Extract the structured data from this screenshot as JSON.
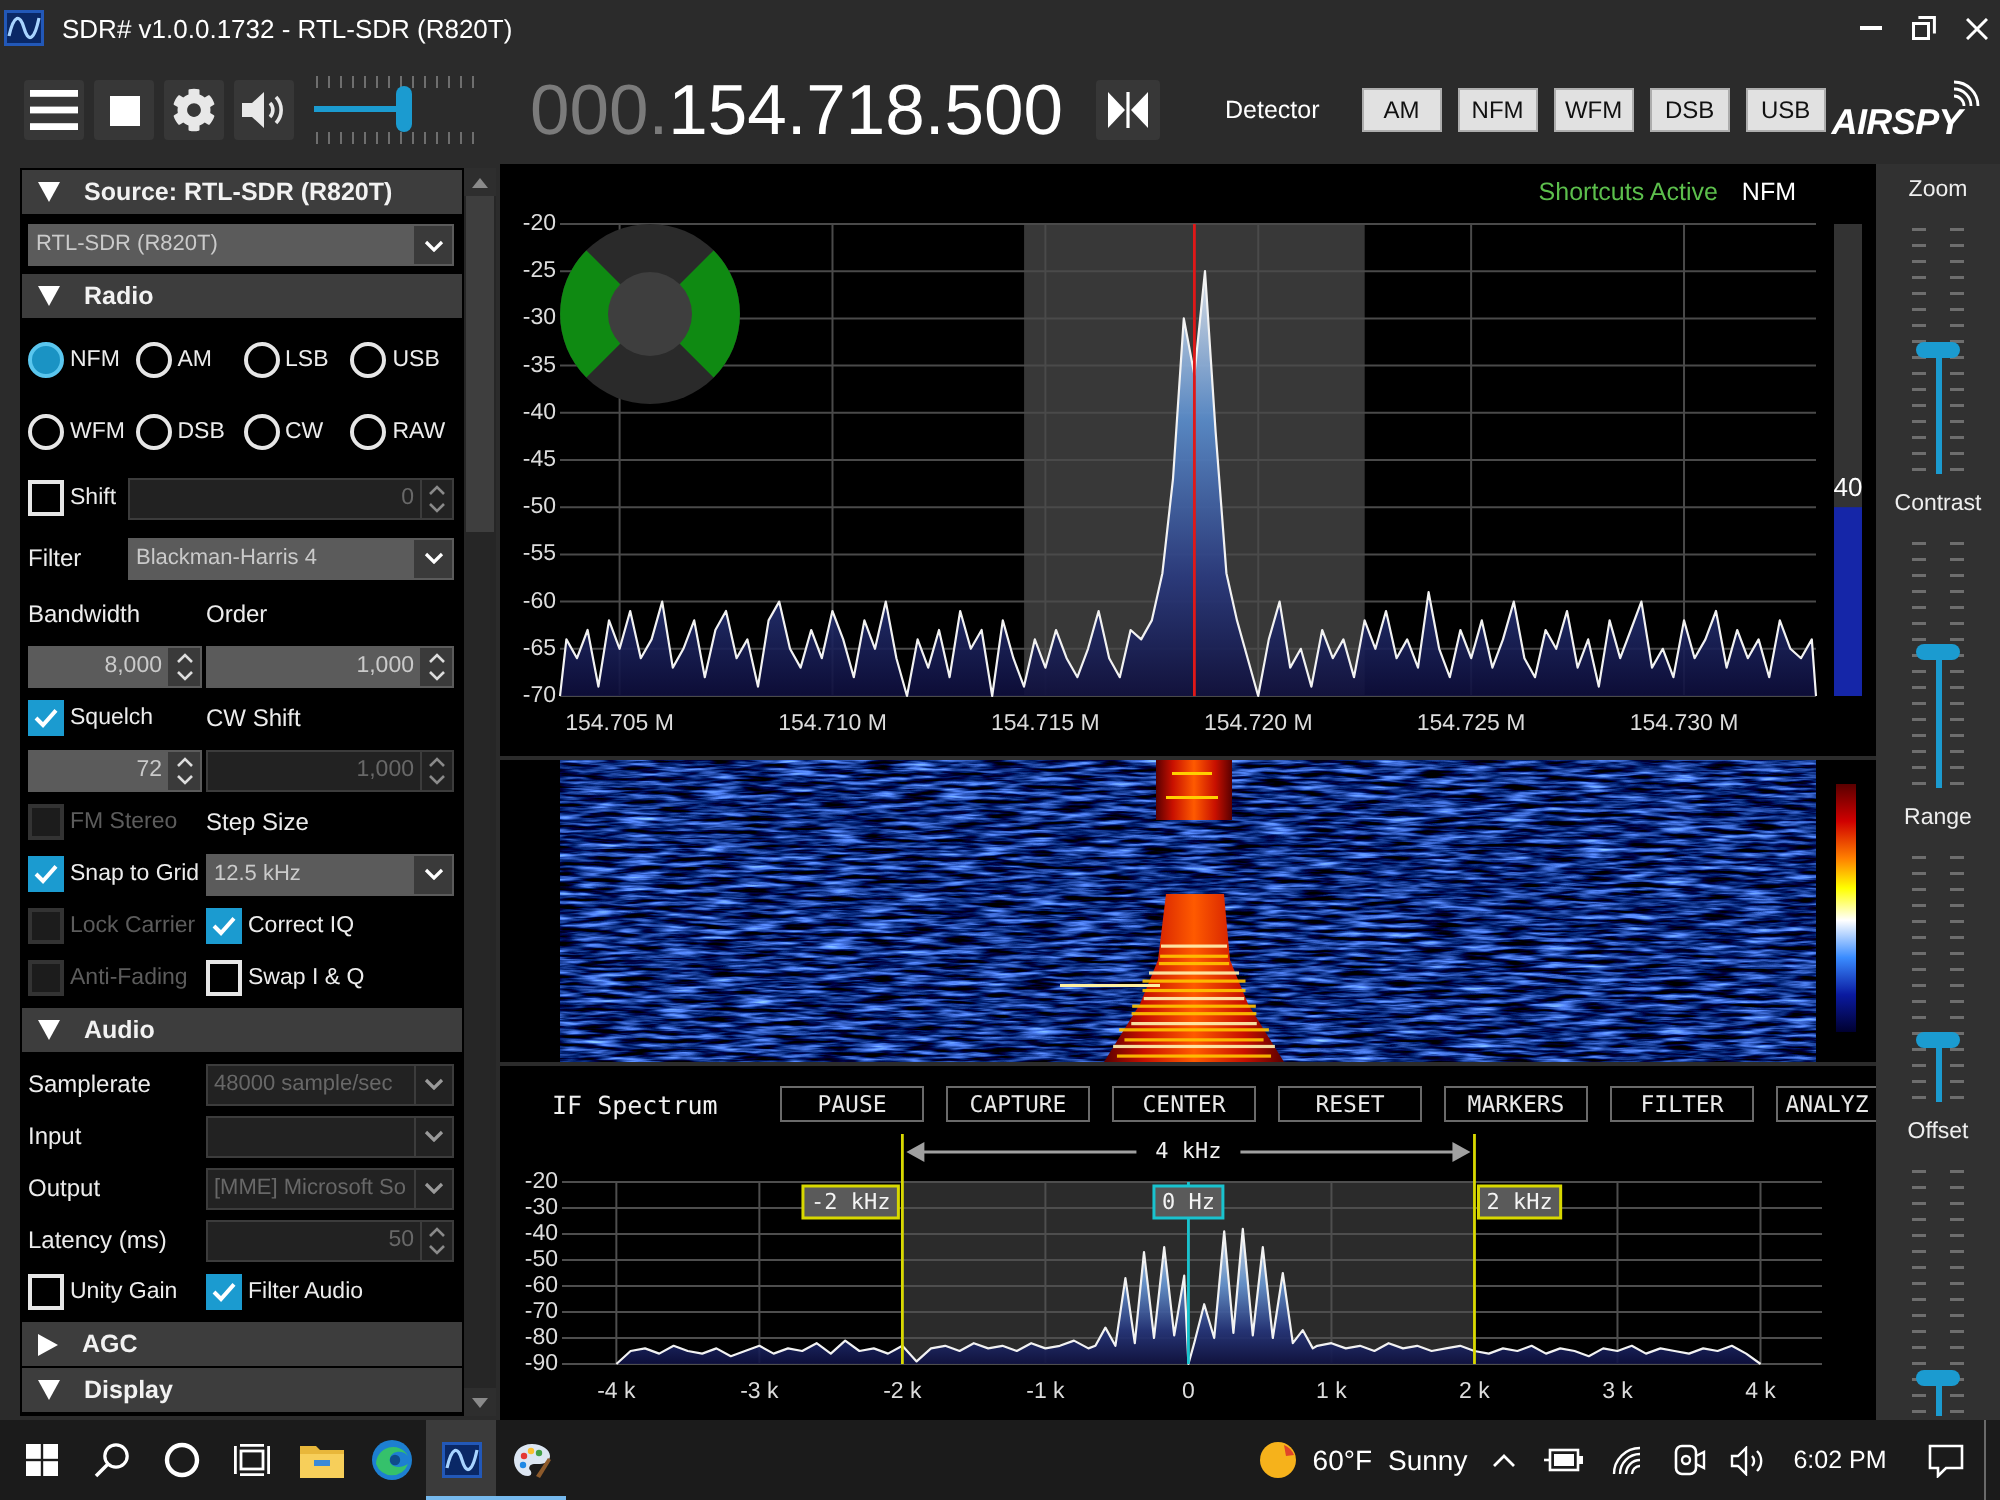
{
  "window": {
    "title": "SDR# v1.0.0.1732 - RTL-SDR (R820T)"
  },
  "toolbar": {
    "volume": {
      "level": 0.55
    },
    "frequency": {
      "prefix": "000.",
      "digits": "154.718.500"
    },
    "detector": {
      "label": "Detector",
      "modes": [
        "AM",
        "NFM",
        "WFM",
        "DSB",
        "USB"
      ]
    },
    "logo": "AIRSPY"
  },
  "side_panel": {
    "sections": [
      {
        "title": "Source: RTL-SDR (R820T)",
        "expanded": true,
        "rows": [
          {
            "kind": "full",
            "cells": [
              {
                "kind": "dropdown",
                "value": "RTL-SDR (R820T)",
                "disabled": false
              }
            ]
          }
        ]
      },
      {
        "title": "Radio",
        "expanded": true,
        "rows": [
          {
            "kind": "radios",
            "cells": [
              {
                "kind": "radio",
                "label": "NFM",
                "selected": true
              },
              {
                "kind": "radio",
                "label": "AM",
                "selected": false
              },
              {
                "kind": "radio",
                "label": "LSB",
                "selected": false
              },
              {
                "kind": "radio",
                "label": "USB",
                "selected": false
              }
            ]
          },
          {
            "kind": "radios",
            "cells": [
              {
                "kind": "radio",
                "label": "WFM",
                "selected": false
              },
              {
                "kind": "radio",
                "label": "DSB",
                "selected": false
              },
              {
                "kind": "radio",
                "label": "CW",
                "selected": false
              },
              {
                "kind": "radio",
                "label": "RAW",
                "selected": false
              }
            ]
          },
          {
            "kind": "short",
            "cells": [
              {
                "kind": "checkbox",
                "label": "Shift",
                "checked": false,
                "disabled": false
              },
              {
                "kind": "spin",
                "value": "0",
                "disabled": true
              }
            ]
          },
          {
            "kind": "short",
            "cells": [
              {
                "kind": "label",
                "label": "Filter"
              },
              {
                "kind": "dropdown",
                "value": "Blackman-Harris 4",
                "disabled": false
              }
            ]
          },
          {
            "kind": "pair",
            "cells": [
              {
                "kind": "label",
                "label": "Bandwidth"
              },
              {
                "kind": "label",
                "label": "Order"
              }
            ]
          },
          {
            "kind": "pair",
            "cells": [
              {
                "kind": "spin",
                "value": "8,000",
                "disabled": false
              },
              {
                "kind": "spin",
                "value": "1,000",
                "disabled": false
              }
            ]
          },
          {
            "kind": "pair",
            "cells": [
              {
                "kind": "checkbox",
                "label": "Squelch",
                "checked": true,
                "disabled": false
              },
              {
                "kind": "label",
                "label": "CW Shift"
              }
            ]
          },
          {
            "kind": "pair",
            "cells": [
              {
                "kind": "spin",
                "value": "72",
                "disabled": false
              },
              {
                "kind": "spin",
                "value": "1,000",
                "disabled": true
              }
            ]
          },
          {
            "kind": "pair",
            "cells": [
              {
                "kind": "checkbox",
                "label": "FM Stereo",
                "checked": false,
                "disabled": true
              },
              {
                "kind": "label",
                "label": "Step Size"
              }
            ]
          },
          {
            "kind": "pair",
            "cells": [
              {
                "kind": "checkbox",
                "label": "Snap to Grid",
                "checked": true,
                "disabled": false
              },
              {
                "kind": "dropdown",
                "value": "12.5 kHz",
                "disabled": false
              }
            ]
          },
          {
            "kind": "pair",
            "cells": [
              {
                "kind": "checkbox",
                "label": "Lock Carrier",
                "checked": false,
                "disabled": true
              },
              {
                "kind": "checkbox",
                "label": "Correct IQ",
                "checked": true,
                "disabled": false
              }
            ]
          },
          {
            "kind": "pair",
            "cells": [
              {
                "kind": "checkbox",
                "label": "Anti-Fading",
                "checked": false,
                "disabled": true
              },
              {
                "kind": "checkbox",
                "label": "Swap I & Q",
                "checked": false,
                "disabled": false
              }
            ]
          }
        ]
      },
      {
        "title": "Audio",
        "expanded": true,
        "rows": [
          {
            "kind": "pair",
            "cells": [
              {
                "kind": "label",
                "label": "Samplerate"
              },
              {
                "kind": "dropdown",
                "value": "48000 sample/sec",
                "disabled": true
              }
            ]
          },
          {
            "kind": "pair",
            "cells": [
              {
                "kind": "label",
                "label": "Input"
              },
              {
                "kind": "dropdown",
                "disabled": true
              }
            ]
          },
          {
            "kind": "pair",
            "cells": [
              {
                "kind": "label",
                "label": "Output"
              },
              {
                "kind": "dropdown",
                "value": "[MME] Microsoft So",
                "disabled": true
              }
            ]
          },
          {
            "kind": "pair",
            "cells": [
              {
                "kind": "label",
                "label": "Latency (ms)"
              },
              {
                "kind": "spin",
                "value": "50",
                "disabled": true
              }
            ]
          },
          {
            "kind": "pair",
            "cells": [
              {
                "kind": "checkbox",
                "label": "Unity Gain",
                "checked": false,
                "disabled": false
              },
              {
                "kind": "checkbox",
                "label": "Filter Audio",
                "checked": true,
                "disabled": false
              }
            ]
          }
        ]
      },
      {
        "title": "AGC",
        "expanded": false
      },
      {
        "title": "Display",
        "expanded": true
      }
    ]
  },
  "spectrum": {
    "status": {
      "shortcuts": "Shortcuts Active",
      "mode": "NFM"
    },
    "chart_data": {
      "type": "area",
      "x": [
        154.7036,
        154.70375,
        154.704,
        154.70425,
        154.7045,
        154.70475,
        154.705,
        154.70525,
        154.7055,
        154.70575,
        154.706,
        154.70625,
        154.7065,
        154.70675,
        154.707,
        154.70725,
        154.7075,
        154.70775,
        154.708,
        154.70825,
        154.7085,
        154.70875,
        154.709,
        154.70925,
        154.7095,
        154.70975,
        154.71,
        154.71025,
        154.7105,
        154.71075,
        154.711,
        154.71125,
        154.7115,
        154.71175,
        154.712,
        154.71225,
        154.7125,
        154.71275,
        154.713,
        154.71325,
        154.7135,
        154.71375,
        154.714,
        154.71425,
        154.7145,
        154.71475,
        154.715,
        154.71525,
        154.7155,
        154.71575,
        154.716,
        154.71625,
        154.7165,
        154.71675,
        154.717,
        154.71725,
        154.7175,
        154.71775,
        154.718,
        154.71825,
        154.7185,
        154.71875,
        154.719,
        154.71925,
        154.7195,
        154.71975,
        154.72,
        154.72025,
        154.7205,
        154.72075,
        154.721,
        154.72125,
        154.7215,
        154.72175,
        154.722,
        154.72225,
        154.7225,
        154.72275,
        154.723,
        154.72325,
        154.7235,
        154.72375,
        154.724,
        154.72425,
        154.7245,
        154.72475,
        154.725,
        154.72525,
        154.7255,
        154.72575,
        154.726,
        154.72625,
        154.7265,
        154.72675,
        154.727,
        154.72725,
        154.7275,
        154.72775,
        154.728,
        154.72825,
        154.7285,
        154.72875,
        154.729,
        154.72925,
        154.7295,
        154.72975,
        154.73,
        154.73025,
        154.7305,
        154.73075,
        154.731,
        154.73125,
        154.7315,
        154.73175,
        154.732,
        154.73225,
        154.7325,
        154.73275,
        154.733,
        154.7331
      ],
      "values": [
        -70,
        -64,
        -66,
        -63,
        -69,
        -62,
        -65,
        -61,
        -66,
        -64,
        -60,
        -67,
        -65,
        -62,
        -68,
        -63,
        -61,
        -66,
        -64,
        -69,
        -62,
        -60,
        -65,
        -67,
        -63,
        -66,
        -61,
        -64,
        -68,
        -62,
        -65,
        -60,
        -66,
        -70,
        -64,
        -67,
        -63,
        -68,
        -61,
        -65,
        -63,
        -70,
        -62,
        -66,
        -69,
        -64,
        -67,
        -63,
        -66,
        -68,
        -65,
        -61,
        -66,
        -68,
        -63,
        -64,
        -62,
        -57,
        -47,
        -30,
        -36,
        -25,
        -42,
        -57,
        -62,
        -66,
        -70,
        -64,
        -60,
        -67,
        -65,
        -69,
        -63,
        -66,
        -64,
        -68,
        -62,
        -65,
        -61,
        -66,
        -64,
        -67,
        -59,
        -65,
        -68,
        -63,
        -66,
        -62,
        -67,
        -64,
        -60,
        -66,
        -68,
        -63,
        -65,
        -61,
        -67,
        -64,
        -69,
        -62,
        -66,
        -63,
        -60,
        -67,
        -65,
        -68,
        -62,
        -66,
        -64,
        -61,
        -67,
        -63,
        -66,
        -64,
        -68,
        -62,
        -65,
        -66,
        -64,
        -70
      ],
      "xlim": [
        154.7036,
        154.7331
      ],
      "ylim": [
        -70,
        -20
      ],
      "xticks": [
        {
          "value": 154.705,
          "label": "154.705 M"
        },
        {
          "value": 154.71,
          "label": "154.710 M"
        },
        {
          "value": 154.715,
          "label": "154.715 M"
        },
        {
          "value": 154.72,
          "label": "154.720 M"
        },
        {
          "value": 154.725,
          "label": "154.725 M"
        },
        {
          "value": 154.73,
          "label": "154.730 M"
        }
      ],
      "yticks": [
        -20,
        -25,
        -30,
        -35,
        -40,
        -45,
        -50,
        -55,
        -60,
        -65,
        -70
      ],
      "grid": true,
      "bands": [
        {
          "axis": "x",
          "from": 154.7145,
          "to": 154.7225,
          "color": "#383838"
        }
      ],
      "ref_lines": [
        {
          "axis": "x",
          "value": 154.7185,
          "color": "#e01818"
        }
      ]
    },
    "meter": {
      "level": 0.4,
      "reading": "40"
    }
  },
  "if_spectrum": {
    "title": "IF Spectrum",
    "buttons": [
      "PAUSE",
      "CAPTURE",
      "CENTER",
      "RESET",
      "MARKERS",
      "FILTER",
      "ANALYZ"
    ],
    "span_label": "4 kHz",
    "markers": [
      {
        "kind": "edge",
        "label": "-2 kHz"
      },
      {
        "kind": "center",
        "label": "0 Hz"
      },
      {
        "kind": "edge",
        "label": "2 kHz"
      }
    ],
    "chart_data": {
      "type": "area",
      "x": [
        -4,
        -3.9,
        -3.8,
        -3.7,
        -3.6,
        -3.5,
        -3.4,
        -3.3,
        -3.2,
        -3.1,
        -3,
        -2.9,
        -2.8,
        -2.7,
        -2.6,
        -2.5,
        -2.4,
        -2.3,
        -2.2,
        -2.1,
        -2,
        -1.9,
        -1.8,
        -1.7,
        -1.6,
        -1.5,
        -1.4,
        -1.3,
        -1.2,
        -1.1,
        -1,
        -0.9,
        -0.8,
        -0.7,
        -0.65,
        -0.58,
        -0.51,
        -0.44,
        -0.375,
        -0.31,
        -0.24,
        -0.17,
        -0.1,
        -0.03,
        0,
        0.04,
        0.11,
        0.18,
        0.25,
        0.315,
        0.38,
        0.45,
        0.52,
        0.59,
        0.66,
        0.73,
        0.8,
        0.87,
        0.9,
        1,
        1.1,
        1.2,
        1.3,
        1.4,
        1.5,
        1.6,
        1.7,
        1.8,
        1.9,
        2,
        2.1,
        2.2,
        2.3,
        2.4,
        2.5,
        2.6,
        2.7,
        2.8,
        2.9,
        3,
        3.1,
        3.2,
        3.3,
        3.4,
        3.5,
        3.6,
        3.7,
        3.8,
        3.9,
        4
      ],
      "values": [
        -90,
        -85,
        -84,
        -86,
        -83,
        -85,
        -86,
        -84,
        -87,
        -85,
        -83,
        -86,
        -84,
        -85,
        -82,
        -86,
        -81,
        -85,
        -84,
        -86,
        -83,
        -89,
        -84,
        -83,
        -85,
        -82,
        -84,
        -83,
        -85,
        -82,
        -84,
        -83,
        -81,
        -84,
        -83,
        -76,
        -83,
        -57,
        -82,
        -47,
        -80,
        -45,
        -79,
        -56,
        -90,
        -82,
        -67,
        -80,
        -39,
        -78,
        -38,
        -79,
        -45,
        -80,
        -55,
        -82,
        -77,
        -84,
        -83,
        -82,
        -84,
        -83,
        -85,
        -82,
        -84,
        -83,
        -85,
        -84,
        -83,
        -85,
        -86,
        -84,
        -85,
        -83,
        -86,
        -84,
        -85,
        -87,
        -84,
        -85,
        -83,
        -86,
        -84,
        -85,
        -86,
        -84,
        -85,
        -83,
        -86,
        -90
      ],
      "xlim": [
        -4.38,
        4.43
      ],
      "ylim": [
        -90,
        -20
      ],
      "xticks": [
        {
          "value": -4,
          "label": "-4 k"
        },
        {
          "value": -3,
          "label": "-3 k"
        },
        {
          "value": -2,
          "label": "-2 k"
        },
        {
          "value": -1,
          "label": "-1 k"
        },
        0,
        {
          "value": 1,
          "label": "1 k"
        },
        {
          "value": 2,
          "label": "2 k"
        },
        {
          "value": 3,
          "label": "3 k"
        },
        {
          "value": 4,
          "label": "4 k"
        }
      ],
      "yticks": [
        -20,
        -30,
        -40,
        -50,
        -60,
        -70,
        -80,
        -90
      ],
      "grid": true,
      "bands": [
        {
          "axis": "x",
          "from": -2,
          "to": 2,
          "color": "#2b2b2b"
        }
      ],
      "ref_lines": [
        {
          "axis": "x",
          "value": -2,
          "color": "#d8d800"
        },
        {
          "axis": "x",
          "value": 0,
          "color": "#19c3cf"
        },
        {
          "axis": "x",
          "value": 2,
          "color": "#d8d800"
        }
      ]
    }
  },
  "view_sliders": [
    {
      "label": "Zoom",
      "level": 0.5
    },
    {
      "label": "Contrast",
      "level": 0.55
    },
    {
      "label": "Range",
      "level": 0.25
    },
    {
      "label": "Offset",
      "level": 0.15
    }
  ],
  "taskbar": {
    "apps": [
      {
        "kind": "folder",
        "running": false,
        "selected": false
      },
      {
        "kind": "browser",
        "running": false,
        "selected": false
      },
      {
        "kind": "sdr",
        "running": true,
        "selected": true
      },
      {
        "kind": "paint",
        "running": true,
        "selected": false
      }
    ],
    "weather": {
      "temperature": "60°F",
      "condition": "Sunny"
    },
    "clock": "6:02 PM"
  }
}
